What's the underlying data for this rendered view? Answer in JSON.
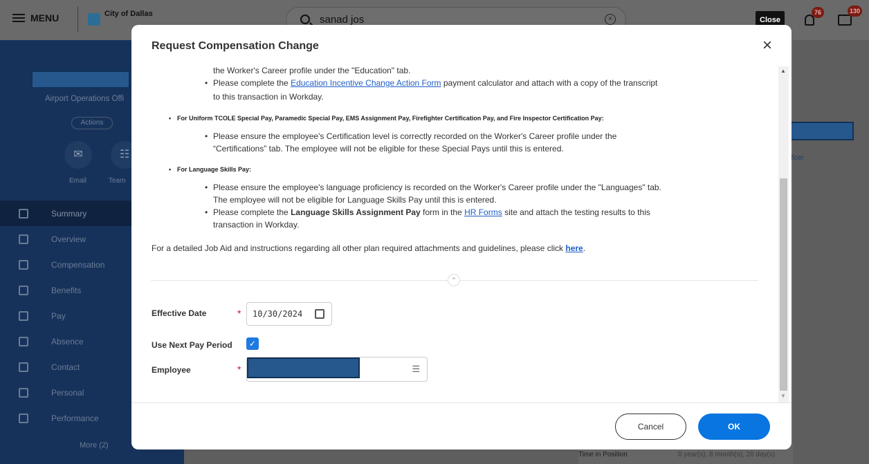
{
  "topbar": {
    "menu_label": "MENU",
    "brand_name": "City of Dallas",
    "search_value": "sanad jos",
    "clear_glyph": "×",
    "close_tooltip": "Close",
    "notifications_count": "76",
    "inbox_count": "130"
  },
  "sidebar": {
    "job_title": "Airport Operations Offi",
    "actions_label": "Actions",
    "email_label": "Email",
    "team_label": "Team",
    "items": [
      {
        "label": "Summary",
        "icon": "summary-icon"
      },
      {
        "label": "Overview",
        "icon": "overview-icon"
      },
      {
        "label": "Compensation",
        "icon": "compensation-icon"
      },
      {
        "label": "Benefits",
        "icon": "benefits-icon"
      },
      {
        "label": "Pay",
        "icon": "pay-icon"
      },
      {
        "label": "Absence",
        "icon": "absence-icon"
      },
      {
        "label": "Contact",
        "icon": "contact-icon"
      },
      {
        "label": "Personal",
        "icon": "personal-icon"
      },
      {
        "label": "Performance",
        "icon": "performance-icon"
      }
    ],
    "more_label": "More (2)"
  },
  "background": {
    "ficer_text": "ficer",
    "time_in_position_label": "Time in Position",
    "time_in_position_value": "0 year(s), 8 month(s), 26 day(s)"
  },
  "modal": {
    "title": "Request Compensation Change",
    "close_glyph": "×",
    "lines": {
      "education_tail": "the Worker's Career profile under the \"Education\" tab.",
      "education_pre": "Please complete the ",
      "education_link": "Education Incentive Change Action Form",
      "education_post": " payment calculator and attach with a copy of the transcript",
      "education_post2": "to this transaction in Workday.",
      "tcole_heading": "For Uniform TCOLE Special Pay, Paramedic Special Pay, EMS Assignment Pay, Firefighter Certification Pay, and Fire Inspector Certification Pay:",
      "cert_1": "Please ensure the employee's Certification level is correctly recorded on the Worker's Career profile under the",
      "cert_2": "“Certifications” tab. The employee will not be eligible for these Special Pays until this is entered.",
      "lang_heading": "For Language Skills Pay:",
      "lang_1": "Please ensure the employee's language proficiency is recorded on the Worker's Career profile under the \"Languages\" tab.",
      "lang_2": "The employee will not be eligible for Language Skills Pay until this is entered.",
      "lang_form_pre": "Please complete the ",
      "lang_form_bold": "Language Skills Assignment Pay",
      "lang_form_mid": " form in the ",
      "lang_form_link": "HR Forms",
      "lang_form_post": " site and attach the testing results to this",
      "lang_form_post2": "transaction in Workday.",
      "jobaid_pre": "For a detailed Job Aid and instructions regarding all other plan required attachments and guidelines, please click ",
      "jobaid_link": "here",
      "jobaid_post": "."
    },
    "form": {
      "effective_date_label": "Effective Date",
      "effective_date_value": "10/30/2024",
      "use_next_pay_label": "Use Next Pay Period",
      "use_next_pay_checked": true,
      "employee_label": "Employee",
      "required_mark": "*"
    },
    "footer": {
      "cancel_label": "Cancel",
      "ok_label": "OK"
    }
  },
  "colors": {
    "accent": "#0875e1",
    "required": "#c8102e",
    "link": "#1f5ec7",
    "badge": "#7a1c14"
  }
}
